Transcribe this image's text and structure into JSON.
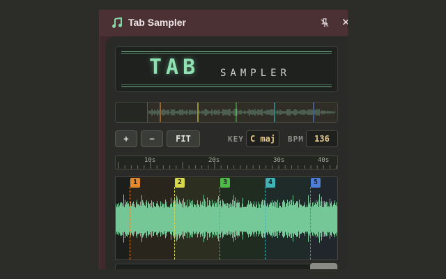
{
  "window": {
    "title": "Tab Sampler",
    "icons": {
      "app": "music-note-icon",
      "pin": "unpin-icon",
      "close": "close-icon"
    },
    "close_glyph": "✕"
  },
  "logo": {
    "big": "TAB",
    "small": "SAMPLER"
  },
  "controls": {
    "zoom_in": "+",
    "zoom_out": "−",
    "fit": "FIT",
    "key_label": "KEY",
    "key_value": "C maj",
    "bpm_label": "BPM",
    "bpm_value": "136"
  },
  "ruler": {
    "labels": [
      "10s",
      "20s",
      "30s",
      "40s"
    ]
  },
  "markers": [
    {
      "label": "1",
      "color": "#e38a2f"
    },
    {
      "label": "2",
      "color": "#d7d84b"
    },
    {
      "label": "3",
      "color": "#4fb94a"
    },
    {
      "label": "4",
      "color": "#3fb3b6"
    },
    {
      "label": "5",
      "color": "#4d7fd8"
    }
  ],
  "colors": {
    "waveform": "#7fd9a4",
    "accent": "#8fe0b2",
    "value_text": "#e8c98d"
  }
}
